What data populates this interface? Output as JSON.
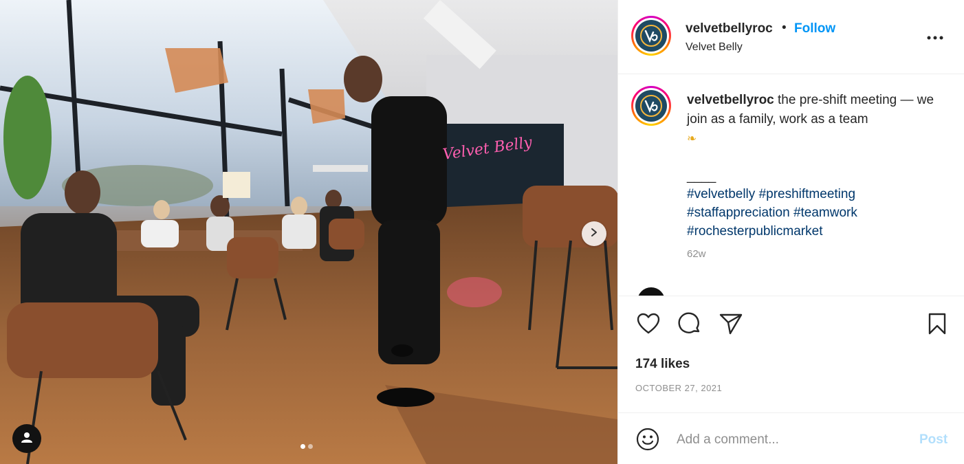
{
  "post": {
    "username": "velvetbellyroc",
    "separator": "•",
    "follow_label": "Follow",
    "location": "Velvet Belly",
    "caption": {
      "username": "velvetbellyroc",
      "text": "the pre-shift meeting — we join as a family, work as a team",
      "emoji": "seahorse",
      "separator_line": "____",
      "hashtags": [
        "#velvetbelly",
        "#preshiftmeeting",
        "#staffappreciation",
        "#teamwork",
        "#rochesterpublicmarket"
      ],
      "age": "62w"
    },
    "likes": "174 likes",
    "date": "OCTOBER 27, 2021",
    "comment": {
      "placeholder": "Add a comment...",
      "post_label": "Post"
    },
    "media": {
      "photo_description_icons": [
        "next-arrow-icon",
        "user-tag-icon"
      ],
      "carousel_index": 1,
      "carousel_count": 2
    }
  },
  "colors": {
    "accent": "#0095f6",
    "hashtag": "#00376b",
    "muted": "#8e8e8e",
    "post_disabled": "#b2dffc",
    "text": "#262626"
  },
  "icons": {
    "more": "more-horizontal-icon",
    "like": "heart-icon",
    "comment": "comment-icon",
    "share": "paper-plane-icon",
    "save": "bookmark-icon",
    "emoji": "smiley-icon",
    "brand": "velvet-belly-logo"
  }
}
